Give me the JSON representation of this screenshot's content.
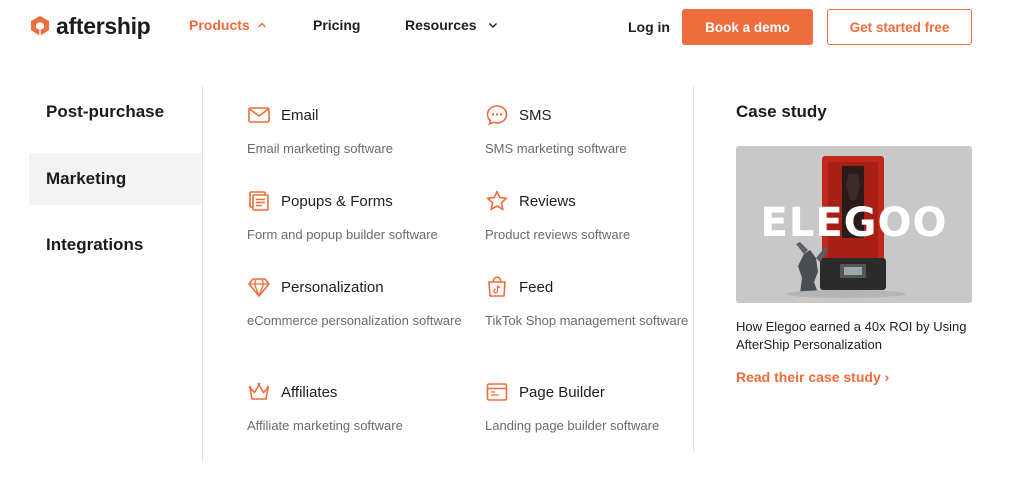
{
  "header": {
    "logo_text": "aftership",
    "nav": [
      {
        "label": "Products",
        "icon": "chevron-up-icon"
      },
      {
        "label": "Pricing"
      },
      {
        "label": "Resources",
        "icon": "chevron-down-icon"
      }
    ],
    "login_label": "Log in",
    "demo_label": "Book a demo",
    "start_label": "Get started free"
  },
  "sidebar": {
    "items": [
      {
        "label": "Post-purchase"
      },
      {
        "label": "Marketing",
        "active": true
      },
      {
        "label": "Integrations"
      }
    ]
  },
  "products": [
    {
      "title": "Email",
      "desc": "Email marketing software",
      "icon": "envelope-icon"
    },
    {
      "title": "SMS",
      "desc": "SMS marketing software",
      "icon": "chat-bubble-icon"
    },
    {
      "title": "Popups & Forms",
      "desc": "Form and popup builder software",
      "icon": "form-icon"
    },
    {
      "title": "Reviews",
      "desc": "Product reviews software",
      "icon": "star-icon"
    },
    {
      "title": "Personalization",
      "desc": "eCommerce personalization software",
      "icon": "diamond-icon"
    },
    {
      "title": "Feed",
      "desc": "TikTok Shop management software",
      "icon": "shopping-bag-icon"
    },
    {
      "title": "Affiliates",
      "desc": "Affiliate marketing software",
      "icon": "crown-icon"
    },
    {
      "title": "Page Builder",
      "desc": "Landing page builder software",
      "icon": "browser-window-icon"
    }
  ],
  "case_study": {
    "heading": "Case study",
    "image_logo": "ELEGOO",
    "text": "How Elegoo earned a 40x ROI by Using AfterShip Personalization",
    "link": "Read their case study ›"
  },
  "colors": {
    "accent": "#ef6c3c",
    "text": "#1f1f1f",
    "muted": "#6b6b6b",
    "active_bg": "#f3f3f3"
  }
}
